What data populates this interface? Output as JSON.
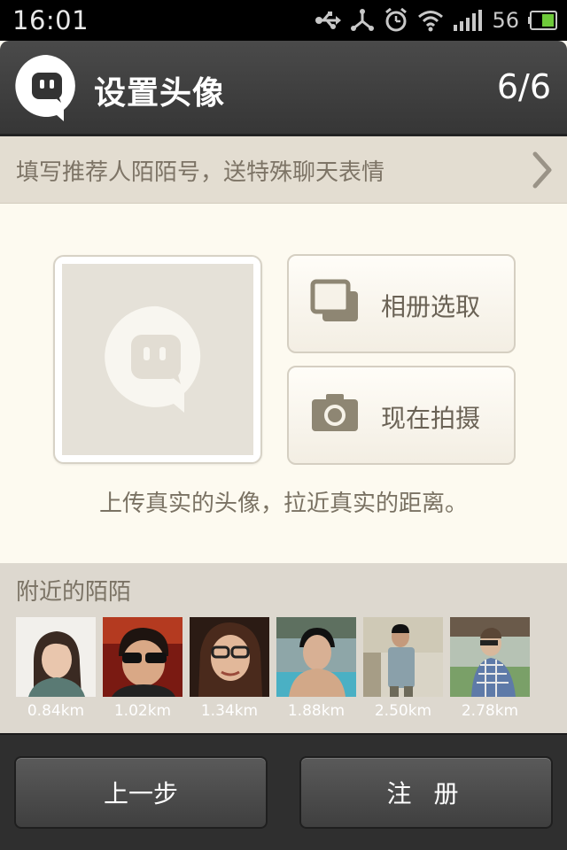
{
  "status_bar": {
    "time": "16:01",
    "battery_level": "56",
    "icons": [
      "usb-icon",
      "share-icon",
      "alarm-icon",
      "wifi-icon",
      "signal-icon",
      "battery-icon"
    ]
  },
  "header": {
    "title": "设置头像",
    "step": "6/6",
    "logo_icon": "momo-logo-icon"
  },
  "referral": {
    "text": "填写推荐人陌陌号，送特殊聊天表情",
    "icon": "chevron-right-icon"
  },
  "avatar": {
    "placeholder_icon": "avatar-placeholder-icon",
    "album_label": "相册选取",
    "album_icon": "album-icon",
    "camera_label": "现在拍摄",
    "camera_icon": "camera-icon",
    "hint": "上传真实的头像，拉近真实的距离。"
  },
  "nearby": {
    "title": "附近的陌陌",
    "people": [
      {
        "distance": "0.84km"
      },
      {
        "distance": "1.02km"
      },
      {
        "distance": "1.34km"
      },
      {
        "distance": "1.88km"
      },
      {
        "distance": "2.50km"
      },
      {
        "distance": "2.78km"
      }
    ]
  },
  "footer": {
    "prev_label": "上一步",
    "register_label": "注 册"
  },
  "colors": {
    "header_bg": "#3e3e3e",
    "banner_bg": "#e3ddd1",
    "content_bg": "#fdfaf0",
    "nearby_bg": "#ddd8cf",
    "footer_bg": "#2f2f2f"
  }
}
